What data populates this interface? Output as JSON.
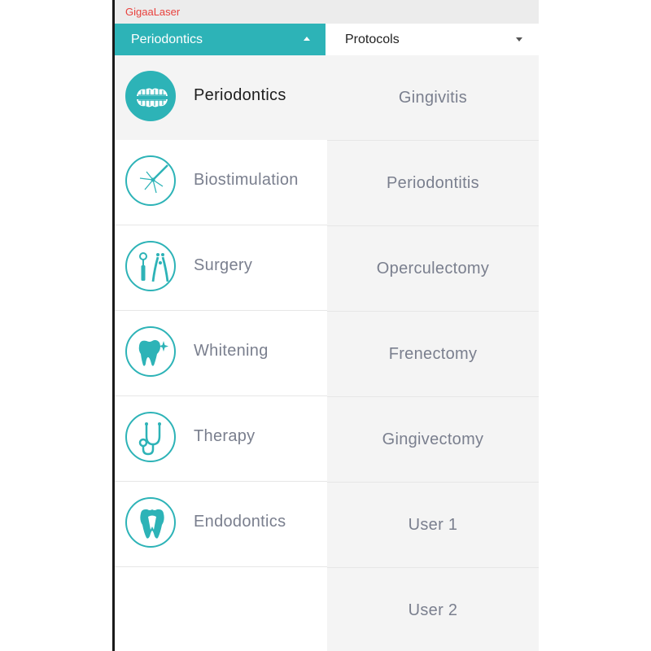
{
  "app": {
    "title": "GigaaLaser"
  },
  "category_dropdown": {
    "selected": "Periodontics",
    "icon": "triangle-up"
  },
  "protocol_dropdown": {
    "selected": "Protocols",
    "icon": "triangle-down"
  },
  "categories": [
    {
      "label": "Periodontics",
      "icon": "teeth-icon",
      "selected": true
    },
    {
      "label": "Biostimulation",
      "icon": "laser-icon",
      "selected": false
    },
    {
      "label": "Surgery",
      "icon": "dental-tools-icon",
      "selected": false
    },
    {
      "label": "Whitening",
      "icon": "sparkle-tooth-icon",
      "selected": false
    },
    {
      "label": "Therapy",
      "icon": "stethoscope-icon",
      "selected": false
    },
    {
      "label": "Endodontics",
      "icon": "tooth-root-icon",
      "selected": false
    }
  ],
  "protocols": [
    {
      "label": "Gingivitis"
    },
    {
      "label": "Periodontitis"
    },
    {
      "label": "Operculectomy"
    },
    {
      "label": "Frenectomy"
    },
    {
      "label": "Gingivectomy"
    },
    {
      "label": "User 1"
    },
    {
      "label": "User 2"
    }
  ],
  "colors": {
    "accent": "#2db3b7",
    "title_red": "#e8413d",
    "text_gray": "#7a7f8e"
  }
}
